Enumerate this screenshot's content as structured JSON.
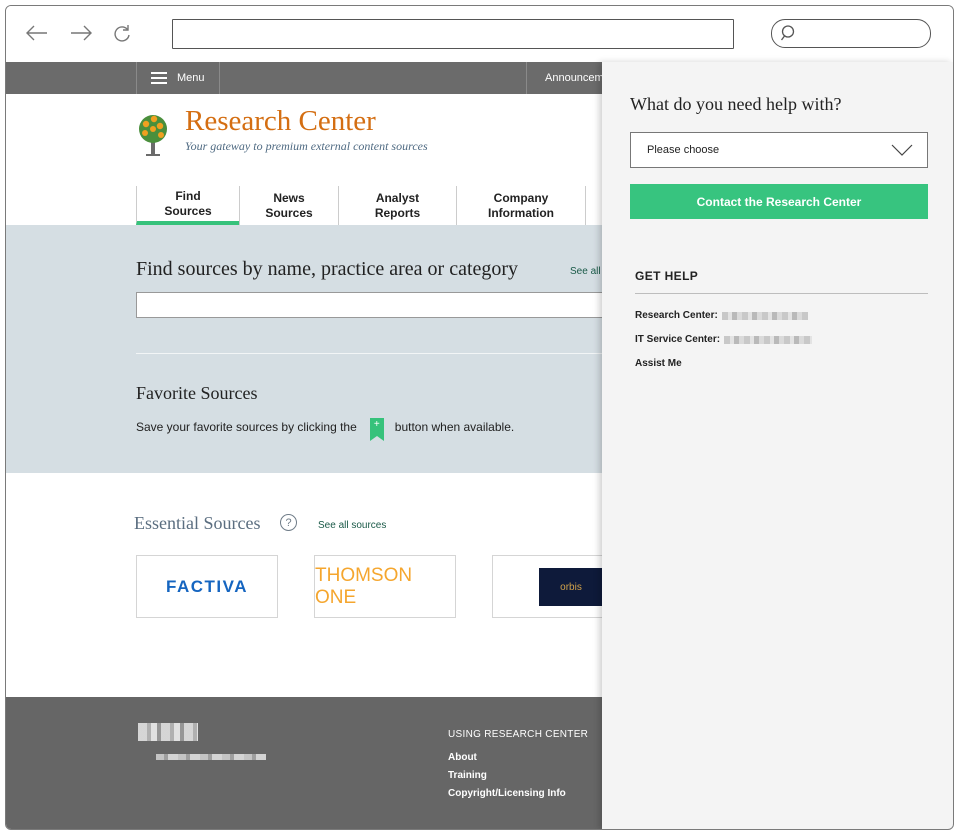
{
  "site": {
    "menu_label": "Menu",
    "announcements_label": "Announcem",
    "brand_title": "Research Center",
    "brand_tagline": "Your gateway to premium external content sources"
  },
  "tabs": [
    {
      "line1": "Find",
      "line2": "Sources",
      "active": true
    },
    {
      "line1": "News",
      "line2": "Sources",
      "active": false
    },
    {
      "line1": "Analyst",
      "line2": "Reports",
      "active": false
    },
    {
      "line1": "Company",
      "line2": "Information",
      "active": false
    }
  ],
  "find": {
    "heading": "Find sources by name, practice area or category",
    "see_all": "See all",
    "input_value": ""
  },
  "favorites": {
    "heading": "Favorite Sources",
    "text_before": "Save your favorite sources by clicking  the",
    "text_after": "button when available.",
    "bookmark_icon": "bookmark-plus-icon"
  },
  "essential": {
    "heading": "Essential Sources",
    "see_all": "See all sources",
    "tiles": [
      "FACTIVA",
      "THOMSON ONE",
      "orbis"
    ]
  },
  "footer": {
    "section_heading": "USING RESEARCH CENTER",
    "links": [
      "About",
      "Training",
      "Copyright/Licensing Info"
    ]
  },
  "help_panel": {
    "title": "What do you need help with?",
    "select_value": "Please choose",
    "button_label": "Contact the Research Center",
    "section_heading": "GET HELP",
    "lines": [
      "Research Center:",
      "IT Service Center:",
      "Assist Me"
    ]
  },
  "colors": {
    "brand_orange": "#d46e12",
    "accent_green": "#37c47f",
    "band_blue_gray": "#d5dee3",
    "footer_gray": "#666666"
  }
}
